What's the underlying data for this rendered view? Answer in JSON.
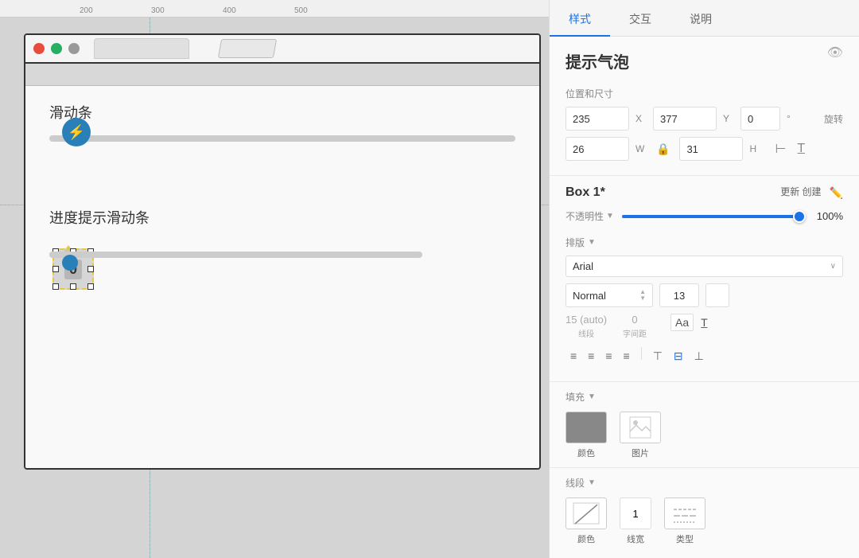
{
  "canvas": {
    "ruler_ticks": [
      "200",
      "300",
      "400",
      "500"
    ],
    "ruler_positions": [
      "100px",
      "190px",
      "280px",
      "370px"
    ],
    "slider_section": {
      "label": "滑动条"
    },
    "progress_section": {
      "label": "进度提示滑动条",
      "value": "0"
    }
  },
  "right_panel": {
    "tabs": [
      {
        "label": "样式",
        "active": true
      },
      {
        "label": "交互",
        "active": false
      },
      {
        "label": "说明",
        "active": false
      }
    ],
    "title": "提示气泡",
    "position_section": {
      "label": "位置和尺寸",
      "x_value": "235",
      "x_label": "X",
      "y_value": "377",
      "y_label": "Y",
      "degree_value": "0",
      "degree_symbol": "°",
      "rotate_label": "旋转",
      "w_value": "26",
      "w_label": "W",
      "h_value": "31",
      "h_label": "H"
    },
    "component_section": {
      "name": "Box 1*",
      "update_label": "更新\n创建"
    },
    "opacity_section": {
      "label": "不透明性",
      "arrow": "▼",
      "value": "100%"
    },
    "typography_section": {
      "label": "排版",
      "arrow": "▼",
      "font_family": "Arial",
      "font_style": "Normal",
      "font_size": "13",
      "line_spacing": "15 (auto)",
      "letter_spacing": "0",
      "line_spacing_label": "线段",
      "letter_spacing_label": "字间距"
    },
    "fill_section": {
      "label": "填充",
      "arrow": "▼",
      "color_label": "颜色",
      "image_label": "图片"
    },
    "line_section": {
      "label": "线段",
      "arrow": "▼",
      "color_label": "颜色",
      "width_value": "1",
      "width_label": "线宽",
      "type_label": "类型"
    }
  }
}
